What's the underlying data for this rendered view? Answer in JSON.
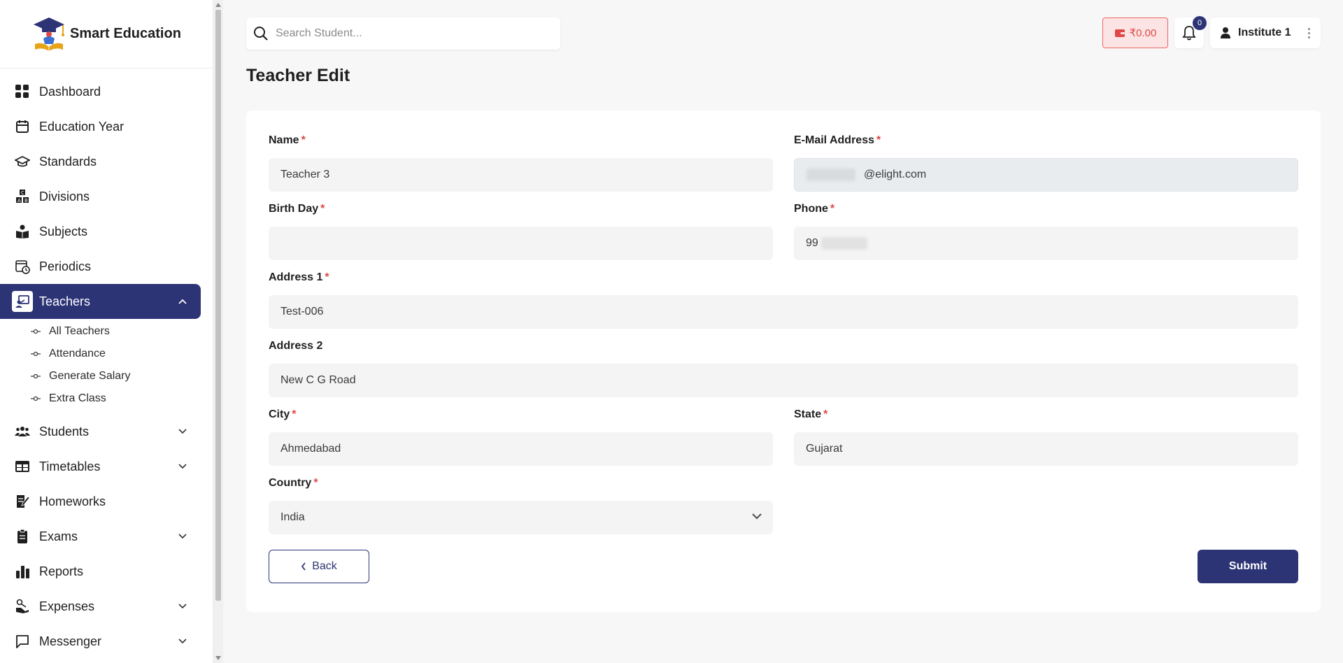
{
  "brand": {
    "name": "Smart Education",
    "icon": "graduation-cap-logo"
  },
  "sidebar": {
    "items": [
      {
        "label": "Dashboard",
        "icon": "dashboard-grid-icon",
        "expandable": false
      },
      {
        "label": "Education Year",
        "icon": "calendar-icon",
        "expandable": false
      },
      {
        "label": "Standards",
        "icon": "mortarboard-icon",
        "expandable": false
      },
      {
        "label": "Divisions",
        "icon": "abc-blocks-icon",
        "expandable": false
      },
      {
        "label": "Subjects",
        "icon": "reader-icon",
        "expandable": false
      },
      {
        "label": "Periodics",
        "icon": "calendar-clock-icon",
        "expandable": false
      },
      {
        "label": "Teachers",
        "icon": "teacher-board-icon",
        "expandable": true,
        "active": true
      },
      {
        "label": "Students",
        "icon": "users-icon",
        "expandable": true
      },
      {
        "label": "Timetables",
        "icon": "table-icon",
        "expandable": true
      },
      {
        "label": "Homeworks",
        "icon": "notebook-pen-icon",
        "expandable": false
      },
      {
        "label": "Exams",
        "icon": "clipboard-icon",
        "expandable": true
      },
      {
        "label": "Reports",
        "icon": "bar-chart-icon",
        "expandable": false
      },
      {
        "label": "Expenses",
        "icon": "hand-coins-icon",
        "expandable": true
      },
      {
        "label": "Messenger",
        "icon": "message-square-icon",
        "expandable": true
      }
    ],
    "teacher_sub": [
      "All Teachers",
      "Attendance",
      "Generate Salary",
      "Extra Class"
    ]
  },
  "search": {
    "placeholder": "Search Student..."
  },
  "header": {
    "wallet": "₹0.00",
    "notifications": "0",
    "user": "Institute 1"
  },
  "page": {
    "title": "Teacher Edit"
  },
  "form": {
    "name_label": "Name",
    "name_value": "Teacher 3",
    "email_label": "E-Mail Address",
    "email_value": "@elight.com",
    "birthday_label": "Birth Day",
    "birthday_value": "",
    "phone_label": "Phone",
    "phone_value": "99",
    "address1_label": "Address 1",
    "address1_value": "Test-006",
    "address2_label": "Address 2",
    "address2_value": "New C G Road",
    "city_label": "City",
    "city_value": "Ahmedabad",
    "state_label": "State",
    "state_value": "Gujarat",
    "country_label": "Country",
    "country_value": "India",
    "required_mark": "*",
    "back_label": "Back",
    "submit_label": "Submit"
  },
  "colors": {
    "primary": "#2d3476",
    "danger": "#e04747",
    "wallet_bg": "#fde4e4"
  }
}
